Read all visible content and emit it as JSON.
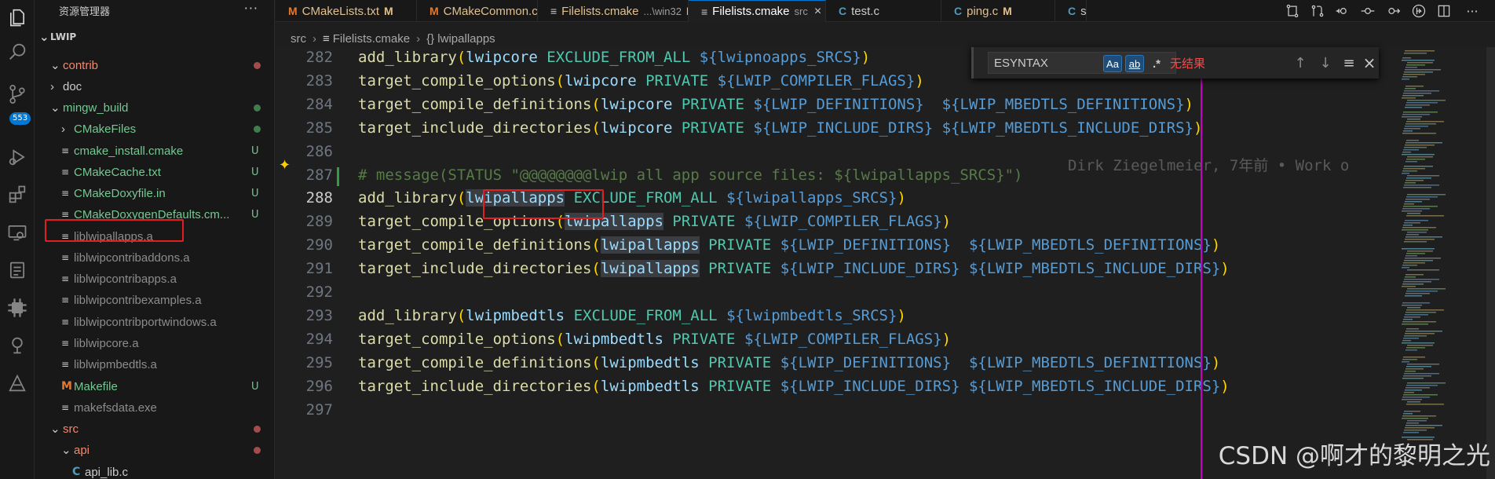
{
  "sidebar": {
    "title": "资源管理器",
    "more": "···",
    "root": "LWIP",
    "items": [
      {
        "label": "contrib",
        "kind": "folder-open",
        "color": "#f48771",
        "status": "dot-red"
      },
      {
        "label": "doc",
        "kind": "folder",
        "color": "#cccccc",
        "status": ""
      },
      {
        "label": "mingw_build",
        "kind": "folder-open",
        "color": "#73c991",
        "status": "dot-green"
      },
      {
        "label": "CMakeFiles",
        "kind": "folder",
        "color": "#73c991",
        "status": "dot-green"
      },
      {
        "label": "cmake_install.cmake",
        "kind": "file",
        "color": "#73c991",
        "status": "U"
      },
      {
        "label": "CMakeCache.txt",
        "kind": "file",
        "color": "#73c991",
        "status": "U"
      },
      {
        "label": "CMakeDoxyfile.in",
        "kind": "file",
        "color": "#73c991",
        "status": "U"
      },
      {
        "label": "CMakeDoxygenDefaults.cm...",
        "kind": "file",
        "color": "#73c991",
        "status": "U"
      },
      {
        "label": "liblwipallapps.a",
        "kind": "file",
        "color": "#8c8c8c",
        "status": ""
      },
      {
        "label": "liblwipcontribaddons.a",
        "kind": "file",
        "color": "#8c8c8c",
        "status": ""
      },
      {
        "label": "liblwipcontribapps.a",
        "kind": "file",
        "color": "#8c8c8c",
        "status": ""
      },
      {
        "label": "liblwipcontribexamples.a",
        "kind": "file",
        "color": "#8c8c8c",
        "status": ""
      },
      {
        "label": "liblwipcontribportwindows.a",
        "kind": "file",
        "color": "#8c8c8c",
        "status": ""
      },
      {
        "label": "liblwipcore.a",
        "kind": "file",
        "color": "#8c8c8c",
        "status": ""
      },
      {
        "label": "liblwipmbedtls.a",
        "kind": "file",
        "color": "#8c8c8c",
        "status": ""
      },
      {
        "label": "Makefile",
        "kind": "makefile",
        "color": "#73c991",
        "status": "U"
      },
      {
        "label": "makefsdata.exe",
        "kind": "file",
        "color": "#8c8c8c",
        "status": ""
      },
      {
        "label": "src",
        "kind": "folder-open",
        "color": "#f48771",
        "status": "dot-red"
      },
      {
        "label": "api",
        "kind": "folder-open",
        "color": "#f48771",
        "status": "dot-red"
      },
      {
        "label": "api_lib.c",
        "kind": "cfile",
        "color": "#cccccc",
        "status": ""
      }
    ]
  },
  "tabs": [
    {
      "label": "CMakeLists.txt",
      "sub": "",
      "mod": "M",
      "icon": "M",
      "active": false
    },
    {
      "label": "CMakeCommon.cmake",
      "sub": "",
      "mod": "M",
      "icon": "M",
      "active": false
    },
    {
      "label": "Filelists.cmake",
      "sub": "...\\win32",
      "mod": "M",
      "icon": "≡",
      "active": false
    },
    {
      "label": "Filelists.cmake",
      "sub": "src",
      "mod": "",
      "icon": "≡",
      "active": true,
      "close": "×"
    },
    {
      "label": "test.c",
      "sub": "",
      "mod": "",
      "icon": "C",
      "active": false
    },
    {
      "label": "ping.c",
      "sub": "",
      "mod": "M",
      "icon": "C",
      "active": false
    },
    {
      "label": "s",
      "sub": "",
      "mod": "",
      "icon": "C",
      "active": false
    }
  ],
  "breadcrumb": [
    "src",
    "Filelists.cmake",
    "{} lwipallapps"
  ],
  "find": {
    "value": "ESYNTAX",
    "opt_case": "Aa",
    "opt_word": "ab",
    "opt_regex": ".*",
    "result": "无结果",
    "prev": "↑",
    "next": "↓",
    "sel": "≡",
    "close": "×"
  },
  "editor": {
    "lines": [
      {
        "n": "282",
        "tokens": [
          [
            "fn",
            "add_library"
          ],
          [
            "pa",
            "("
          ],
          [
            "id",
            "lwipcore"
          ],
          [
            "sp",
            " "
          ],
          [
            "kw",
            "EXCLUDE_FROM_ALL"
          ],
          [
            "sp",
            " "
          ],
          [
            "dl",
            "${"
          ],
          [
            "va",
            "lwipnoapps_SRCS"
          ],
          [
            "dl",
            "}"
          ],
          [
            "pa",
            ")"
          ]
        ]
      },
      {
        "n": "283",
        "tokens": [
          [
            "fn",
            "target_compile_options"
          ],
          [
            "pa",
            "("
          ],
          [
            "id",
            "lwipcore"
          ],
          [
            "sp",
            " "
          ],
          [
            "kw",
            "PRIVATE"
          ],
          [
            "sp",
            " "
          ],
          [
            "dl",
            "${"
          ],
          [
            "va",
            "LWIP_COMPILER_FLAGS"
          ],
          [
            "dl",
            "}"
          ],
          [
            "pa",
            ")"
          ]
        ]
      },
      {
        "n": "284",
        "tokens": [
          [
            "fn",
            "target_compile_definitions"
          ],
          [
            "pa",
            "("
          ],
          [
            "id",
            "lwipcore"
          ],
          [
            "sp",
            " "
          ],
          [
            "kw",
            "PRIVATE"
          ],
          [
            "sp",
            " "
          ],
          [
            "dl",
            "${"
          ],
          [
            "va",
            "LWIP_DEFINITIONS"
          ],
          [
            "dl",
            "}"
          ],
          [
            "sp",
            "  "
          ],
          [
            "dl",
            "${"
          ],
          [
            "va",
            "LWIP_MBEDTLS_DEFINITIONS"
          ],
          [
            "dl",
            "}"
          ],
          [
            "pa",
            ")"
          ]
        ]
      },
      {
        "n": "285",
        "tokens": [
          [
            "fn",
            "target_include_directories"
          ],
          [
            "pa",
            "("
          ],
          [
            "id",
            "lwipcore"
          ],
          [
            "sp",
            " "
          ],
          [
            "kw",
            "PRIVATE"
          ],
          [
            "sp",
            " "
          ],
          [
            "dl",
            "${"
          ],
          [
            "va",
            "LWIP_INCLUDE_DIRS"
          ],
          [
            "dl",
            "}"
          ],
          [
            "sp",
            " "
          ],
          [
            "dl",
            "${"
          ],
          [
            "va",
            "LWIP_MBEDTLS_INCLUDE_DIRS"
          ],
          [
            "dl",
            "}"
          ],
          [
            "pa",
            ")"
          ]
        ]
      },
      {
        "n": "286",
        "tokens": []
      },
      {
        "n": "287",
        "tokens": [
          [
            "cm",
            "# message(STATUS \"@@@@@@@@lwip all app source files: ${lwipallapps_SRCS}\")"
          ]
        ]
      },
      {
        "n": "288",
        "tokens": [
          [
            "fn",
            "add_library"
          ],
          [
            "pa",
            "("
          ],
          [
            "idhl",
            "lwipallapps"
          ],
          [
            "sp",
            " "
          ],
          [
            "kw",
            "EXCLUDE_FROM_ALL"
          ],
          [
            "sp",
            " "
          ],
          [
            "dl",
            "${"
          ],
          [
            "va",
            "lwipallapps_SRCS"
          ],
          [
            "dl",
            "}"
          ],
          [
            "pa",
            ")"
          ]
        ]
      },
      {
        "n": "289",
        "tokens": [
          [
            "fn",
            "target_compile_options"
          ],
          [
            "pa",
            "("
          ],
          [
            "idhl",
            "lwipallapps"
          ],
          [
            "sp",
            " "
          ],
          [
            "kw",
            "PRIVATE"
          ],
          [
            "sp",
            " "
          ],
          [
            "dl",
            "${"
          ],
          [
            "va",
            "LWIP_COMPILER_FLAGS"
          ],
          [
            "dl",
            "}"
          ],
          [
            "pa",
            ")"
          ]
        ]
      },
      {
        "n": "290",
        "tokens": [
          [
            "fn",
            "target_compile_definitions"
          ],
          [
            "pa",
            "("
          ],
          [
            "idhl",
            "lwipallapps"
          ],
          [
            "sp",
            " "
          ],
          [
            "kw",
            "PRIVATE"
          ],
          [
            "sp",
            " "
          ],
          [
            "dl",
            "${"
          ],
          [
            "va",
            "LWIP_DEFINITIONS"
          ],
          [
            "dl",
            "}"
          ],
          [
            "sp",
            "  "
          ],
          [
            "dl",
            "${"
          ],
          [
            "va",
            "LWIP_MBEDTLS_DEFINITIONS"
          ],
          [
            "dl",
            "}"
          ],
          [
            "pa",
            ")"
          ]
        ]
      },
      {
        "n": "291",
        "tokens": [
          [
            "fn",
            "target_include_directories"
          ],
          [
            "pa",
            "("
          ],
          [
            "idhl",
            "lwipallapps"
          ],
          [
            "sp",
            " "
          ],
          [
            "kw",
            "PRIVATE"
          ],
          [
            "sp",
            " "
          ],
          [
            "dl",
            "${"
          ],
          [
            "va",
            "LWIP_INCLUDE_DIRS"
          ],
          [
            "dl",
            "}"
          ],
          [
            "sp",
            " "
          ],
          [
            "dl",
            "${"
          ],
          [
            "va",
            "LWIP_MBEDTLS_INCLUDE_DIRS"
          ],
          [
            "dl",
            "}"
          ],
          [
            "pa",
            ")"
          ]
        ]
      },
      {
        "n": "292",
        "tokens": []
      },
      {
        "n": "293",
        "tokens": [
          [
            "fn",
            "add_library"
          ],
          [
            "pa",
            "("
          ],
          [
            "id",
            "lwipmbedtls"
          ],
          [
            "sp",
            " "
          ],
          [
            "kw",
            "EXCLUDE_FROM_ALL"
          ],
          [
            "sp",
            " "
          ],
          [
            "dl",
            "${"
          ],
          [
            "va",
            "lwipmbedtls_SRCS"
          ],
          [
            "dl",
            "}"
          ],
          [
            "pa",
            ")"
          ]
        ]
      },
      {
        "n": "294",
        "tokens": [
          [
            "fn",
            "target_compile_options"
          ],
          [
            "pa",
            "("
          ],
          [
            "id",
            "lwipmbedtls"
          ],
          [
            "sp",
            " "
          ],
          [
            "kw",
            "PRIVATE"
          ],
          [
            "sp",
            " "
          ],
          [
            "dl",
            "${"
          ],
          [
            "va",
            "LWIP_COMPILER_FLAGS"
          ],
          [
            "dl",
            "}"
          ],
          [
            "pa",
            ")"
          ]
        ]
      },
      {
        "n": "295",
        "tokens": [
          [
            "fn",
            "target_compile_definitions"
          ],
          [
            "pa",
            "("
          ],
          [
            "id",
            "lwipmbedtls"
          ],
          [
            "sp",
            " "
          ],
          [
            "kw",
            "PRIVATE"
          ],
          [
            "sp",
            " "
          ],
          [
            "dl",
            "${"
          ],
          [
            "va",
            "LWIP_DEFINITIONS"
          ],
          [
            "dl",
            "}"
          ],
          [
            "sp",
            "  "
          ],
          [
            "dl",
            "${"
          ],
          [
            "va",
            "LWIP_MBEDTLS_DEFINITIONS"
          ],
          [
            "dl",
            "}"
          ],
          [
            "pa",
            ")"
          ]
        ]
      },
      {
        "n": "296",
        "tokens": [
          [
            "fn",
            "target_include_directories"
          ],
          [
            "pa",
            "("
          ],
          [
            "id",
            "lwipmbedtls"
          ],
          [
            "sp",
            " "
          ],
          [
            "kw",
            "PRIVATE"
          ],
          [
            "sp",
            " "
          ],
          [
            "dl",
            "${"
          ],
          [
            "va",
            "LWIP_INCLUDE_DIRS"
          ],
          [
            "dl",
            "}"
          ],
          [
            "sp",
            " "
          ],
          [
            "dl",
            "${"
          ],
          [
            "va",
            "LWIP_MBEDTLS_INCLUDE_DIRS"
          ],
          [
            "dl",
            "}"
          ],
          [
            "pa",
            ")"
          ]
        ]
      },
      {
        "n": "297",
        "tokens": []
      }
    ],
    "current_line": "288",
    "blame": "Dirk Ziegelmeier, 7年前 • Work o",
    "sparkle": "✦"
  },
  "activity_badge": "553",
  "watermark": "CSDN @啊才的黎明之光",
  "colors": {
    "accent": "#0078d4",
    "annotation": "#e02020",
    "modified": "#e2c08d",
    "untracked": "#73c991",
    "error": "#f48771"
  }
}
